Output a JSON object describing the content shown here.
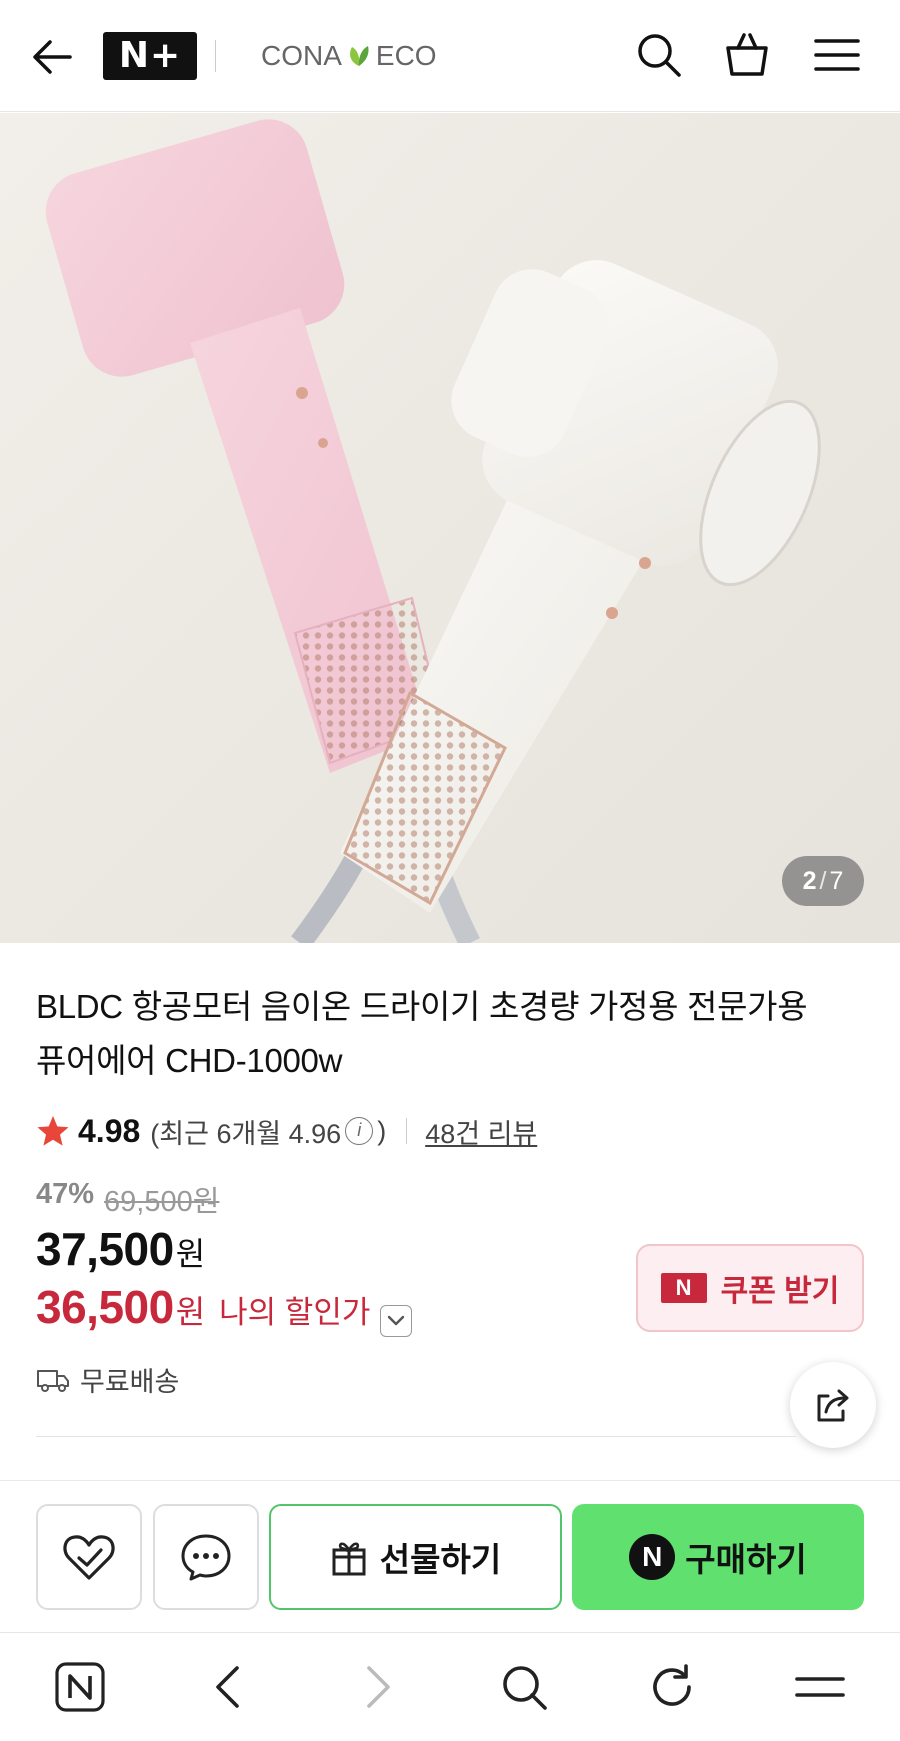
{
  "header": {
    "back_icon": "arrow-left-icon",
    "logo_text": "N+",
    "brand_left": "CONA",
    "brand_right": "ECO",
    "icons": [
      "search-icon",
      "shopping-bag-icon",
      "hamburger-menu-icon"
    ]
  },
  "gallery": {
    "current": "2",
    "total": "7",
    "separator": "/"
  },
  "product": {
    "title_line1": "BLDC 항공모터 음이온 드라이기 초경량 가정용 전문가용",
    "title_line2": "퓨어에어 CHD-1000w",
    "rating": "4.98",
    "recent_prefix": "(최근 6개월 4.96",
    "recent_suffix": ")",
    "info_glyph": "i",
    "reviews": "48건 리뷰",
    "discount_pct": "47%",
    "original_price": "69,500원",
    "price": "37,500",
    "price_unit": "원",
    "my_price": "36,500",
    "my_price_unit": "원",
    "my_price_label": "나의 할인가",
    "coupon_badge": "N",
    "coupon_label": "쿠폰 받기",
    "shipping": "무료배송"
  },
  "actions": {
    "gift_label": "선물하기",
    "buy_badge": "N",
    "buy_label": "구매하기"
  },
  "browser_nav": {
    "icons": [
      "naver-home-icon",
      "back-chevron-icon",
      "forward-chevron-icon",
      "search-icon",
      "refresh-icon",
      "menu-icon"
    ]
  },
  "colors": {
    "accent_red": "#c8283b",
    "buy_green": "#5fe06f",
    "gift_border": "#52c56a",
    "star": "#e8463a"
  }
}
